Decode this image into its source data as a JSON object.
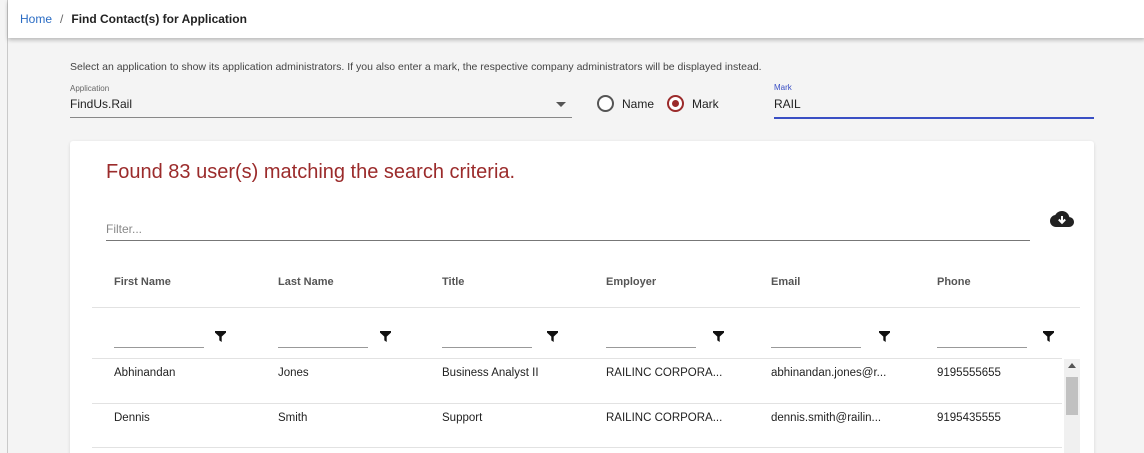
{
  "breadcrumb": {
    "home": "Home",
    "separator": "/",
    "current": "Find Contact(s) for Application"
  },
  "form": {
    "instructions": "Select an application to show its application administrators. If you also enter a mark, the respective company administrators will be displayed instead.",
    "application_label": "Application",
    "application_value": "FindUs.Rail",
    "radio_name_label": "Name",
    "radio_mark_label": "Mark",
    "selected_radio": "Mark",
    "mark_label": "Mark",
    "mark_value": "RAIL"
  },
  "results": {
    "message": "Found 83 user(s) matching the search criteria.",
    "filter_placeholder": "Filter...",
    "columns": [
      "First Name",
      "Last Name",
      "Title",
      "Employer",
      "Email",
      "Phone"
    ],
    "rows": [
      [
        "Abhinandan",
        "Jones",
        "Business Analyst II",
        "RAILINC CORPORA...",
        "abhinandan.jones@r...",
        "9195555655"
      ],
      [
        "Dennis",
        "Smith",
        "Support",
        "RAILINC CORPORA...",
        "dennis.smith@railin...",
        "9195435555"
      ]
    ]
  },
  "icons": {
    "download": "cloud-download-icon",
    "column_filter": "funnel-icon",
    "dropdown": "chevron-down-icon"
  },
  "colors": {
    "accent_red": "#9b2b2b",
    "focus_blue": "#3a4fc4",
    "link_blue": "#2a6cc4"
  }
}
